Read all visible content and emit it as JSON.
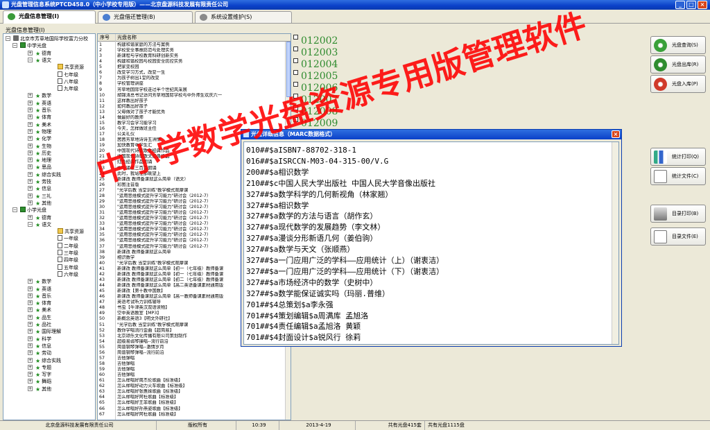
{
  "window": {
    "title": "光盘管理信息系统PTCD458.0（中小学校专用版）——北京盘源科技发展有限责任公司"
  },
  "tabs": [
    {
      "label": "光盘信息管理(I)"
    },
    {
      "label": "光盘借还管理(B)"
    },
    {
      "label": "系统设置维护(S)"
    }
  ],
  "section_label": "光盘信息管理(I)",
  "tree": {
    "root": "北京市芳草地国际学校富力分校",
    "middle": {
      "label": "中学光盘",
      "subjects_top": [
        "德育",
        "语文"
      ],
      "yuwen_children": [
        "共享资源",
        "七年级",
        "八年级",
        "九年级"
      ],
      "subjects_rest": [
        "数学",
        "英语",
        "音乐",
        "体育",
        "美术",
        "物理",
        "化学",
        "生物",
        "历史",
        "地理",
        "思品",
        "综合实践",
        "劳技",
        "信息",
        "三礼",
        "其他"
      ]
    },
    "primary": {
      "label": "小学光盘",
      "subjects_top": [
        "德育",
        "语文"
      ],
      "yuwen_children": [
        "共享资源",
        "一年级",
        "二年级",
        "三年级",
        "四年级",
        "五年级",
        "六年级"
      ],
      "subjects_rest": [
        "数学",
        "英语",
        "音乐",
        "体育",
        "美术",
        "品生",
        "品社",
        "国际理解",
        "科学",
        "信息",
        "劳动",
        "综合实践",
        "专题",
        "写字",
        "舞蹈",
        "其他"
      ]
    }
  },
  "list": {
    "col_no": "序号",
    "col_name": "光盘名称",
    "rows": [
      [
        "1",
        "构建和谐家庭的方法与案例"
      ],
      [
        "2",
        "学校安全事故防范与处理实务"
      ],
      [
        "3",
        "新课程与学校教育科研创新实务"
      ],
      [
        "4",
        "构建和谐校园与校园安全防控实务"
      ],
      [
        "5",
        "把家变校园"
      ],
      [
        "6",
        "改变学习方式，改变一生"
      ],
      [
        "7",
        "为孩子树出1堂的改变"
      ],
      [
        "8",
        "学校管理讲座"
      ],
      [
        "9",
        "芳草地国际学校走过半个世纪风采展"
      ],
      [
        "10",
        "胡锦涛总书记访问芳草地国际学校与中外师生欢庆六一"
      ],
      [
        "11",
        "这样教出好孩子"
      ],
      [
        "12",
        "如何教出好孩子"
      ],
      [
        "13",
        "父母做对了孩子才能优秀"
      ],
      [
        "14",
        "做最好的教师"
      ],
      [
        "15",
        "教学习会学习能学习"
      ],
      [
        "16",
        "今天，怎样做班主任"
      ],
      [
        "17",
        "公关礼仪"
      ],
      [
        "18",
        "茜茜芳草地诗诗五洲情"
      ],
      [
        "19",
        "加快教育中学生汇"
      ],
      [
        "20",
        "中国现代诗歌散文经典作品"
      ],
      [
        "21",
        "中国现代诗歌散文经典作品"
      ],
      [
        "22",
        "红色经典作品朗诵"
      ],
      [
        "23",
        "中华诵读三百首朗诵"
      ],
      [
        "24",
        "此时，我站在那眺望上"
      ],
      [
        "25",
        "新课改 教师备课就这么简单（语文）"
      ],
      [
        "26",
        "彩图注音版"
      ],
      [
        "27",
        "\"光学后教 当堂训练\"教学模式观摩课"
      ],
      [
        "28",
        "\"运用思维模式提升学习能力\"研讨会（2012-7）"
      ],
      [
        "29",
        "\"运用思维模式提升学习能力\"研讨会（2012-7）"
      ],
      [
        "30",
        "\"运用思维模式提升学习能力\"研讨会（2012-7）"
      ],
      [
        "31",
        "\"运用思维模式提升学习能力\"研讨会（2012-7）"
      ],
      [
        "32",
        "\"运用思维模式提升学习能力\"研讨会（2012-7）"
      ],
      [
        "33",
        "\"运用思维模式提升学习能力\"研讨会（2012-7）"
      ],
      [
        "34",
        "\"运用思维模式提升学习能力\"研讨会（2012-7）"
      ],
      [
        "35",
        "\"运用思维模式提升学习能力\"研讨会（2012-7）"
      ],
      [
        "36",
        "\"运用思维模式提升学习能力\"研讨会（2012-7）"
      ],
      [
        "37",
        "\"运用思维模式提升学习能力\"研讨会（2012-7）"
      ],
      [
        "38",
        "新课改 教师备课就这么简单"
      ],
      [
        "39",
        "相识数学"
      ],
      [
        "40",
        "\"光学后教 当堂训练\"教学模式观摩课"
      ],
      [
        "41",
        "新课改 教师备课就这么简单【初一（七年级）教师备课"
      ],
      [
        "42",
        "新课改 教师备课就这么简单【初一（七年级）教师备课"
      ],
      [
        "43",
        "新课改 教师备课就这么简单【初二（七年级）教师备课"
      ],
      [
        "44",
        "新课改 教师备课就这么简单【高二英语备课素材通用版"
      ],
      [
        "45",
        "新课改【第十教中国数】"
      ],
      [
        "46",
        "新课改 教师备课就这么简单【高一教师备课素材通用版"
      ],
      [
        "47",
        "英语考试听力训练辅导"
      ],
      [
        "48",
        "书虫【牛津英汉双语读物】"
      ],
      [
        "49",
        "空中英语教室【MP3】"
      ],
      [
        "50",
        "新概念英语3【明文外研社】"
      ],
      [
        "51",
        "\"光学后教 当堂训练\"教学模式观摩课"
      ],
      [
        "52",
        "教你学唱流行金曲【超简易】"
      ],
      [
        "53",
        "北京颂乐文化传播有限公司策划制作"
      ],
      [
        "54",
        "超级易弱琴操唱--流行前沿"
      ],
      [
        "55",
        "简谱钢琴弹唱--激情岁月"
      ],
      [
        "56",
        "简谱钢琴弹唱--流行前沿"
      ],
      [
        "57",
        "吉他弹唱"
      ],
      [
        "58",
        "吉他弹唱"
      ],
      [
        "59",
        "吉他弹唱"
      ],
      [
        "60",
        "吉他弹唱"
      ],
      [
        "61",
        "怎么样唱好周杰伦歌曲【标准级】"
      ],
      [
        "62",
        "怎么样唱好动力火车歌曲【标准级】"
      ],
      [
        "63",
        "怎么样唱好张惠妹歌曲【标准级】"
      ],
      [
        "64",
        "怎么样唱好阿杜歌曲【标准级】"
      ],
      [
        "65",
        "怎么样唱好王菲歌曲【标准级】"
      ],
      [
        "66",
        "怎么样唱好孙燕姿歌曲【标准级】"
      ],
      [
        "67",
        "怎么样唱好阿杜歌曲【标准级】"
      ]
    ]
  },
  "isbn_numbers": [
    "012002",
    "012003",
    "012004",
    "012005",
    "012006",
    "012007",
    "012008",
    "012009"
  ],
  "buttons": {
    "query": "光盘查询(S)",
    "checkout": "光盘出库(R)",
    "checkin": "光盘入库(P)",
    "stat_print": "统计打印(Q)",
    "stat_file": "统计文件(C)",
    "cat_print": "目录打印(B)",
    "cat_file": "目录文件(E)"
  },
  "dialog": {
    "title": "光盘详细信息（MARC数据格式）",
    "lines": [
      "010##$aISBN7-88702-318-1",
      "016##$aISRCCN-M03-04-315-00/V.G",
      "200##$a相识数学",
      "210##$c中国人民大学出版社 中国人民大学音像出版社",
      "327##$a数学科学的几何新视角（林家翘）",
      "327##$a相识数学",
      "327##$a数学的方法与语言（胡作玄）",
      "327##$a现代数学的发展趋势（李文林）",
      "327##$a漫谈分形新语几何（姜伯驹）",
      "327##$a数学与天文（张顺燕）",
      "327##$a一门应用广泛的学科——应用统计（上）（谢衷洁）",
      "327##$a一门应用广泛的学科——应用统计（下）（谢衷洁）",
      "327##$a市场经济中的数学（史树中）",
      "327##$a数学能保证诚实吗（玛丽.普维）",
      "701##$4总策划$a李永强",
      "701##$4策划编辑$a周满库 孟旭洛",
      "701##$4责任编辑$a孟旭洛 黄颖",
      "701##$4封面设计$a锐风行 徐莉"
    ]
  },
  "watermark": "中小学数学光盘资源专用版管理软件",
  "status": {
    "company": "北京盘源科技发展有限责任公司",
    "copyright": "版权所有",
    "time": "10:39",
    "date": "2013-4-19",
    "sets": "共有光盘415套",
    "discs": "共有光盘1115盘"
  },
  "colors": {
    "titlebar": "#0a40c8",
    "isbn_green": "#2e8b2e",
    "watermark_red": "#ff0000"
  }
}
